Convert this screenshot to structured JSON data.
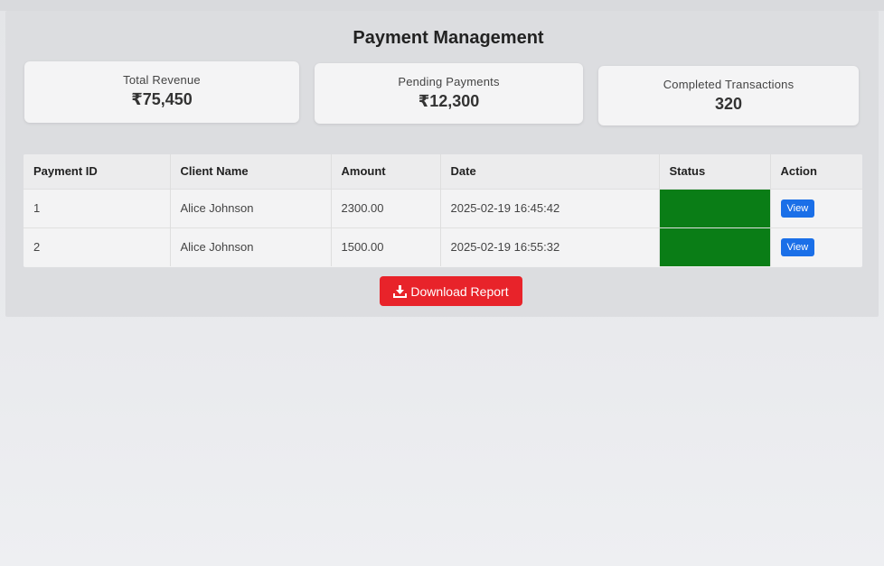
{
  "header": {
    "title": "Payment Management"
  },
  "summary": [
    {
      "label": "Total Revenue",
      "value": "₹75,450"
    },
    {
      "label": "Pending Payments",
      "value": "₹12,300"
    },
    {
      "label": "Completed Transactions",
      "value": "320"
    }
  ],
  "table": {
    "headers": [
      "Payment ID",
      "Client Name",
      "Amount",
      "Date",
      "Status",
      "Action"
    ],
    "rows": [
      {
        "id": "1",
        "client": "Alice Johnson",
        "amount": "2300.00",
        "date": "2025-02-19 16:45:42",
        "action": "View"
      },
      {
        "id": "2",
        "client": "Alice Johnson",
        "amount": "1500.00",
        "date": "2025-02-19 16:55:32",
        "action": "View"
      }
    ]
  },
  "colors": {
    "status": "#0a7d16",
    "view_button": "#1a6fe8",
    "download_button": "#e8232a"
  },
  "download": {
    "label": "Download Report",
    "icon": "download-icon"
  }
}
